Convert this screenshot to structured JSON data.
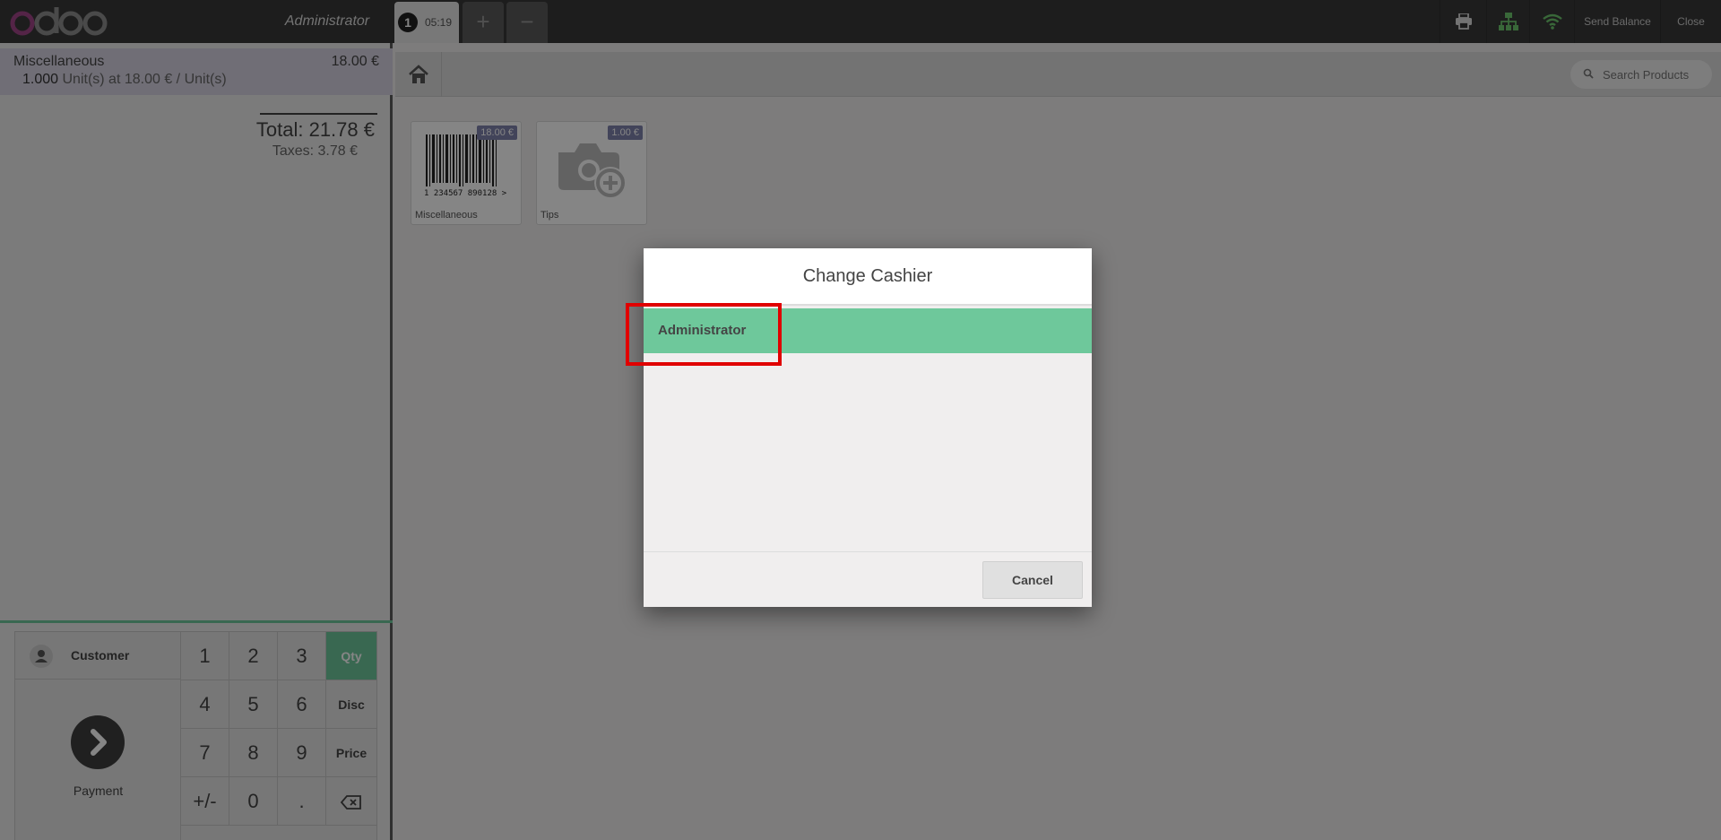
{
  "header": {
    "logo_text": "odoo",
    "cashier_name": "Administrator",
    "order_tab": {
      "number": "1",
      "time": "05:19"
    },
    "add_order_symbol": "+",
    "remove_order_symbol": "−",
    "send_balance_label": "Send Balance",
    "close_label": "Close"
  },
  "order": {
    "lines": [
      {
        "product": "Miscellaneous",
        "price": "18.00 €",
        "quantity": "1.000",
        "unit_info": "Unit(s) at 18.00 € / Unit(s)"
      }
    ],
    "total_label": "Total: 21.78 €",
    "taxes_label": "Taxes: 3.78 €"
  },
  "numpad": {
    "customer_label": "Customer",
    "payment_label": "Payment",
    "keys": [
      "1",
      "2",
      "3",
      "4",
      "5",
      "6",
      "7",
      "8",
      "9",
      "+/-",
      "0",
      "."
    ],
    "modes": [
      "Qty",
      "Disc",
      "Price"
    ],
    "active_mode": "Qty"
  },
  "products": {
    "search_placeholder": "Search Products",
    "items": [
      {
        "name": "Miscellaneous",
        "price": "18.00 €",
        "barcode_text": "1 234567 890128 >"
      },
      {
        "name": "Tips",
        "price": "1.00 €"
      }
    ]
  },
  "modal": {
    "title": "Change Cashier",
    "options": [
      "Administrator"
    ],
    "selected": "Administrator",
    "cancel_label": "Cancel"
  },
  "colors": {
    "accent_green": "#6ec89b",
    "header_bg": "#393939",
    "logo_purple": "#a24689",
    "highlight_red": "#e00000"
  }
}
